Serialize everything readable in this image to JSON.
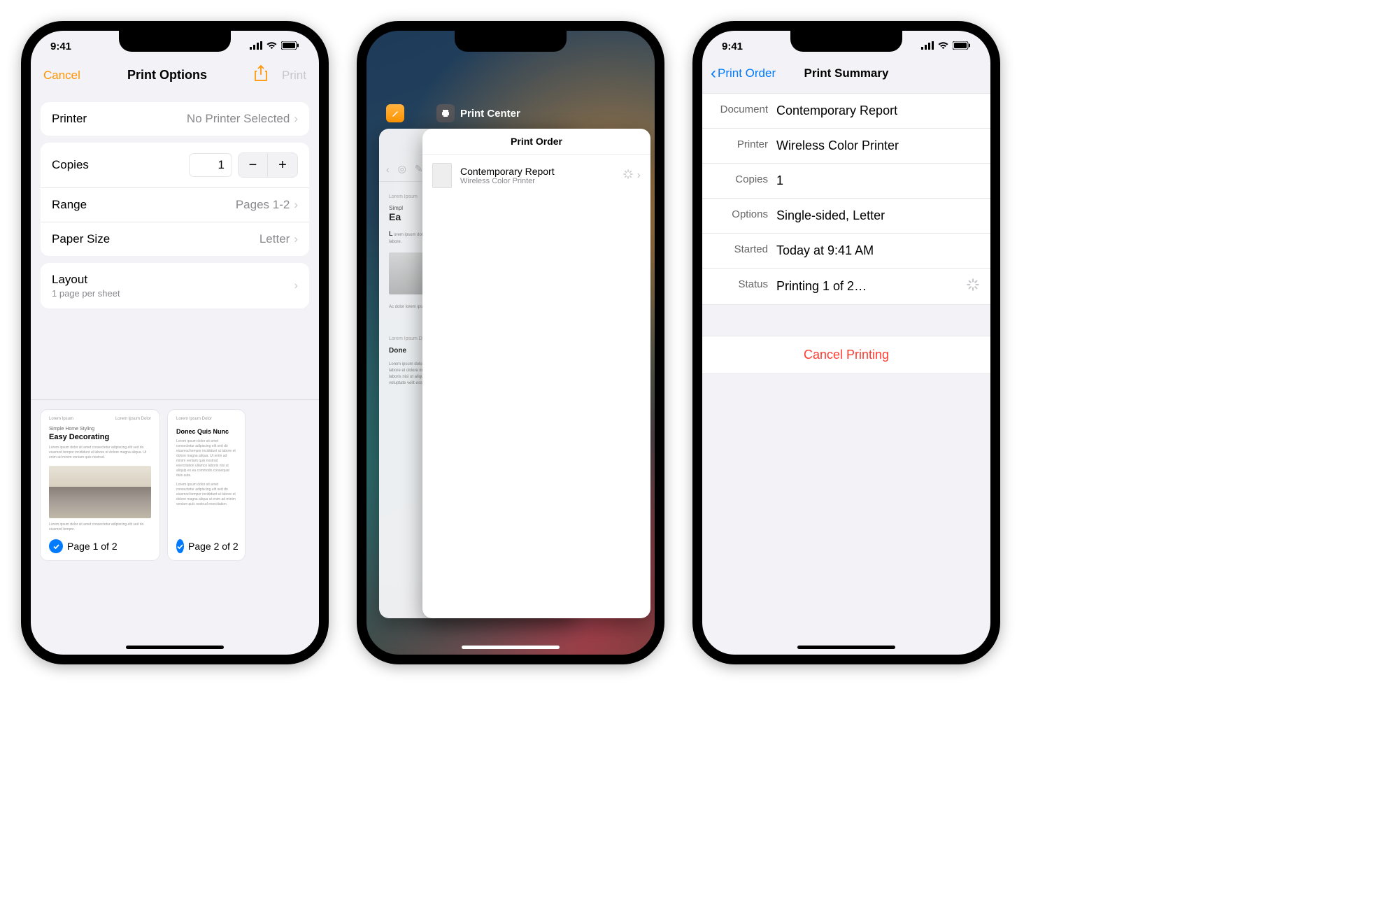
{
  "status_time": "9:41",
  "phone1": {
    "nav": {
      "cancel": "Cancel",
      "title": "Print Options",
      "print": "Print"
    },
    "printer": {
      "label": "Printer",
      "value": "No Printer Selected"
    },
    "copies": {
      "label": "Copies",
      "value": "1"
    },
    "range": {
      "label": "Range",
      "value": "Pages 1-2"
    },
    "paper": {
      "label": "Paper Size",
      "value": "Letter"
    },
    "layout": {
      "label": "Layout",
      "sub": "1 page per sheet"
    },
    "preview": {
      "doc_subtitle": "Simple Home Styling",
      "doc_title": "Easy Decorating",
      "page2_heading": "Donec Quis Nunc",
      "pages": [
        {
          "label": "Page 1 of 2"
        },
        {
          "label": "Page 2 of 2"
        }
      ]
    }
  },
  "phone2": {
    "app_label": "Print Center",
    "card_title": "Print Order",
    "item": {
      "name": "Contemporary Report",
      "printer": "Wireless Color Printer"
    },
    "back_doc": {
      "sub": "Simpl",
      "title": "Ea",
      "heading2": "Done"
    }
  },
  "phone3": {
    "nav": {
      "back": "Print Order",
      "title": "Print Summary"
    },
    "rows": {
      "document": {
        "label": "Document",
        "value": "Contemporary Report"
      },
      "printer": {
        "label": "Printer",
        "value": "Wireless Color Printer"
      },
      "copies": {
        "label": "Copies",
        "value": "1"
      },
      "options": {
        "label": "Options",
        "value": "Single-sided, Letter"
      },
      "started": {
        "label": "Started",
        "value": "Today at  9:41 AM"
      },
      "status": {
        "label": "Status",
        "value": "Printing 1 of 2…"
      }
    },
    "cancel": "Cancel Printing"
  }
}
